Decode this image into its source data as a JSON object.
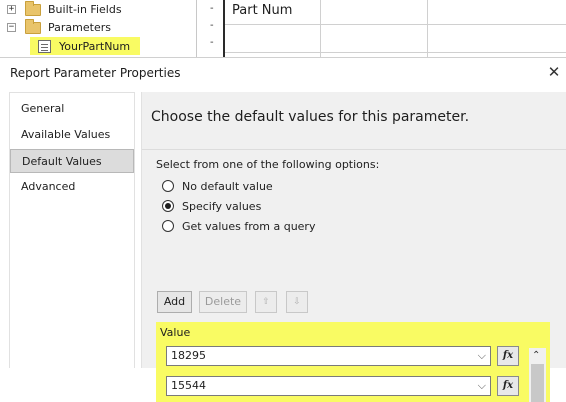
{
  "tree": {
    "builtin_fields": "Built-in Fields",
    "parameters": "Parameters",
    "param_item": "YourPartNum",
    "expand_symbol": "+",
    "collapse_symbol": "−"
  },
  "designer": {
    "row_markers": [
      "-",
      "-",
      "-"
    ],
    "header_cell": "Part Num"
  },
  "dialog": {
    "title": "Report Parameter Properties",
    "close_glyph": "✕",
    "nav": [
      "General",
      "Available Values",
      "Default Values",
      "Advanced"
    ],
    "selected_nav": "Default Values",
    "heading": "Choose the default values for this parameter.",
    "options_label": "Select from one of the following options:",
    "options": [
      {
        "label": "No default value",
        "checked": false
      },
      {
        "label": "Specify values",
        "checked": true
      },
      {
        "label": "Get values from a query",
        "checked": false
      }
    ],
    "buttons": {
      "add": "Add",
      "delete": "Delete",
      "move_up_glyph": "⇧",
      "move_down_glyph": "⇩"
    },
    "values_header": "Value",
    "values": [
      "18295",
      "15544"
    ],
    "dropdown_glyph": "⌵",
    "fx_label": "fx",
    "scroll_up_glyph": "⌃"
  },
  "colors": {
    "highlight": "#f9fb63",
    "content_bg": "#f0f0f0",
    "selected_nav_bg": "#dcdcdc"
  }
}
